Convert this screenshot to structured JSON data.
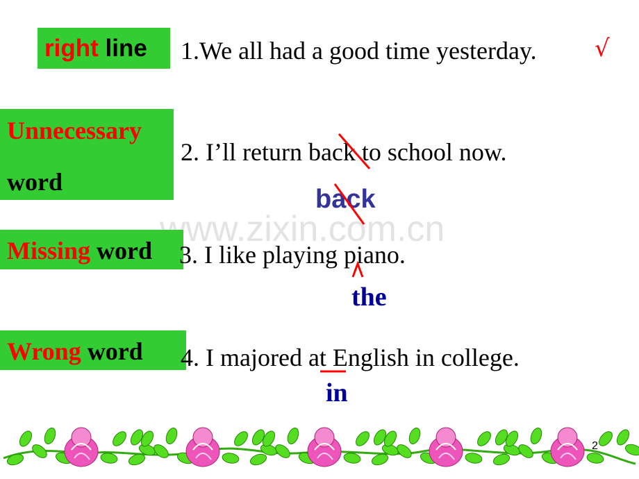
{
  "watermark": "www.zixin.com.cn",
  "rows": [
    {
      "label_red": "right",
      "label_black": "line",
      "sentence": "1.We all had a good time yesterday.",
      "mark": "√"
    },
    {
      "label_red": "Unnecessary",
      "label_black": "word",
      "sentence": "2. I’ll return back to school now.",
      "correction": "back"
    },
    {
      "label_red": "Missing",
      "label_black": "word",
      "sentence": "3. I like playing  piano.",
      "correction": "the",
      "mark": "^"
    },
    {
      "label_red": "Wrong",
      "label_black": "word",
      "sentence": "4. I majored at English in college.",
      "correction": "in"
    }
  ],
  "page_number": "2",
  "colors": {
    "label_bg": "#33cc33",
    "accent_red": "#ff0000",
    "correction_blue": "#333399",
    "correction_navy": "#000099"
  }
}
